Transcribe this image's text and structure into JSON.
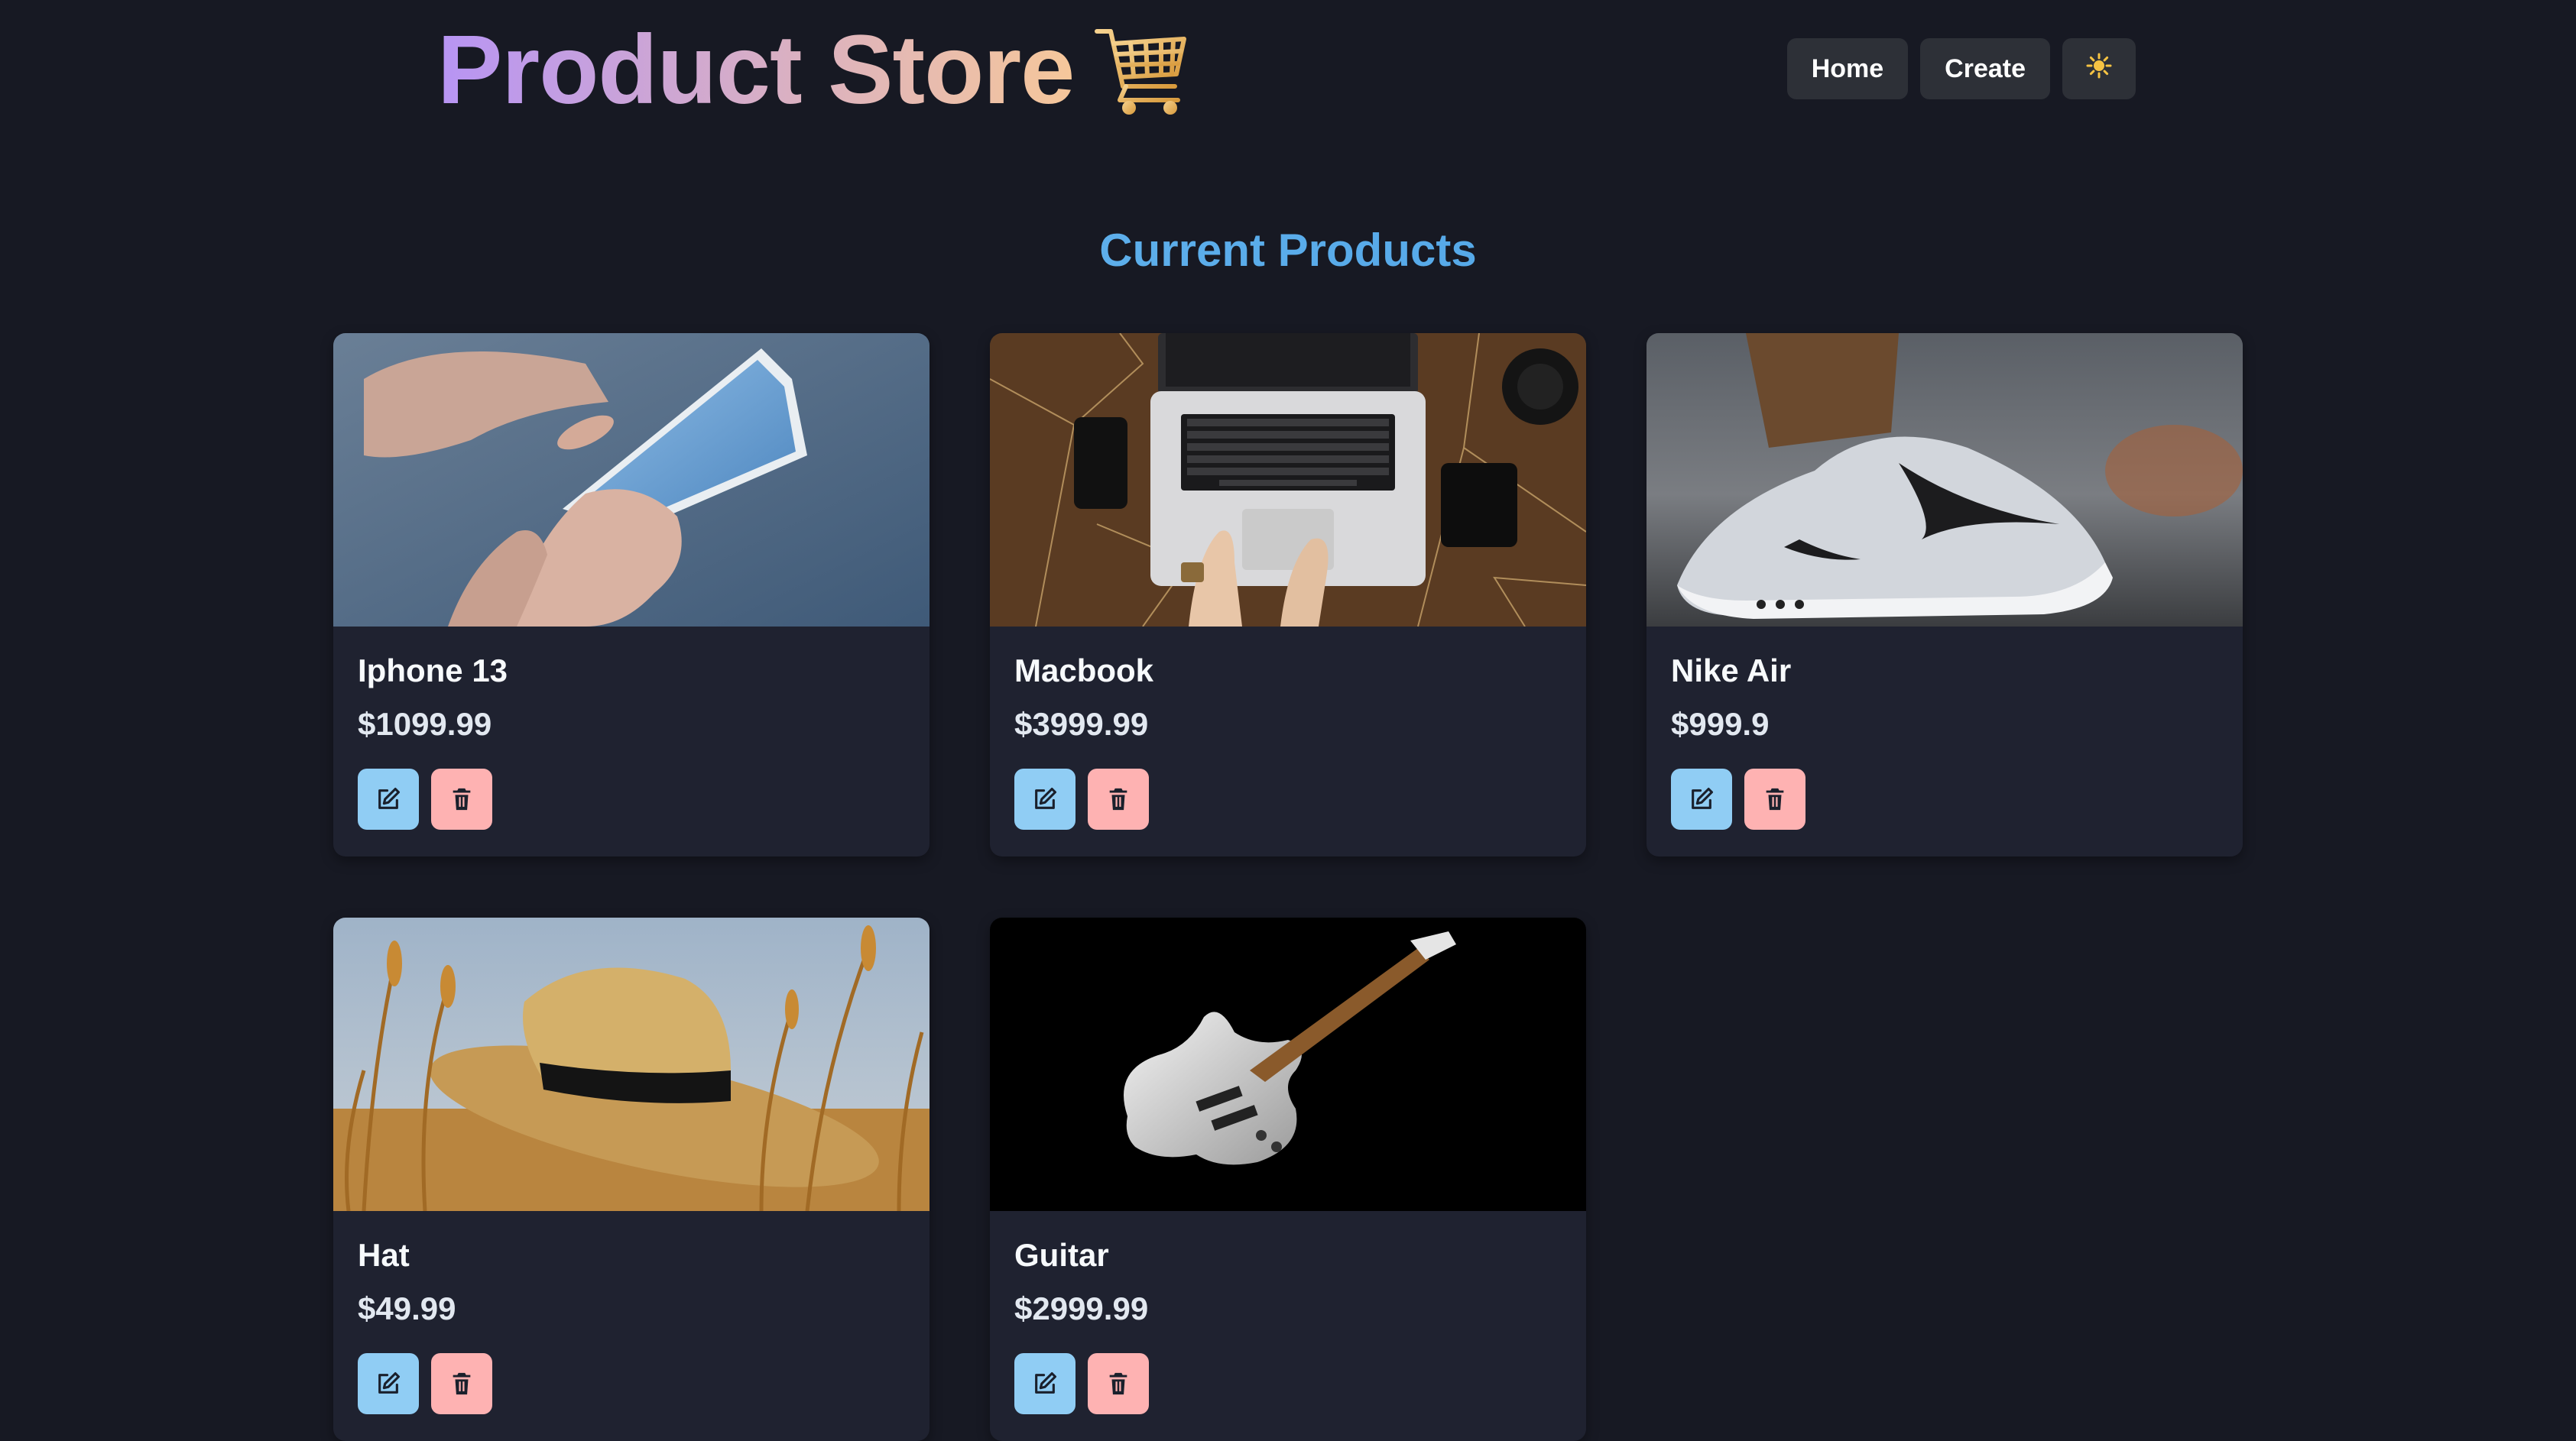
{
  "header": {
    "brand": "Product Store",
    "brand_icon": "shopping-cart-icon",
    "nav": {
      "home_label": "Home",
      "create_label": "Create",
      "theme_icon": "☀️"
    }
  },
  "main": {
    "title": "Current Products",
    "products": [
      {
        "name": "Iphone 13",
        "price": "$1099.99",
        "image": "smartphone-photo"
      },
      {
        "name": "Macbook",
        "price": "$3999.99",
        "image": "laptop-photo"
      },
      {
        "name": "Nike Air",
        "price": "$999.9",
        "image": "sneaker-photo"
      },
      {
        "name": "Hat",
        "price": "$49.99",
        "image": "straw-hat-photo"
      },
      {
        "name": "Guitar",
        "price": "$2999.99",
        "image": "electric-guitar-photo"
      }
    ]
  },
  "colors": {
    "background": "#171923",
    "card": "#1f2230",
    "edit_button": "#90cdf4",
    "delete_button": "#feb2b2",
    "title_gradient": [
      "#63b3ed",
      "#4299e1"
    ],
    "brand_gradient": [
      "#b794f4",
      "#f6c79a"
    ]
  }
}
